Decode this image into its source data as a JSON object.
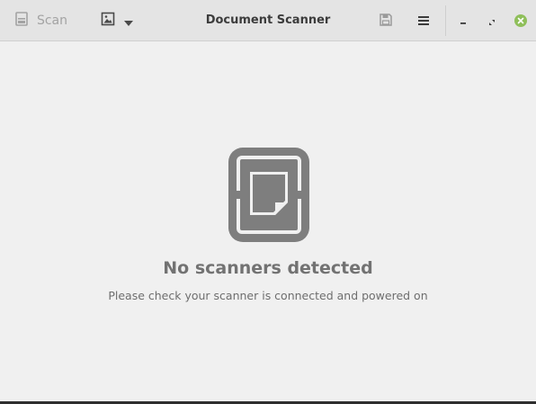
{
  "window": {
    "title": "Document Scanner"
  },
  "toolbar": {
    "scan_label": "Scan",
    "scan_icon": "scanner-icon",
    "type_icon": "image-icon",
    "type_dropdown_icon": "chevron-down-icon",
    "save_icon": "save-icon",
    "menu_icon": "hamburger-menu-icon"
  },
  "window_controls": {
    "minimize_icon": "minimize-icon",
    "maximize_icon": "maximize-icon",
    "close_icon": "close-icon",
    "close_color": "#8fbf5a"
  },
  "empty_state": {
    "icon": "document-scanner-icon",
    "title": "No scanners detected",
    "subtitle": "Please check your scanner is connected and powered on",
    "icon_color": "#7e7e7e"
  },
  "colors": {
    "headerbar": "#e4e4e4",
    "background": "#f0f0f0",
    "disabled_text": "#a3a3a3",
    "title_text": "#3c3c3c"
  }
}
